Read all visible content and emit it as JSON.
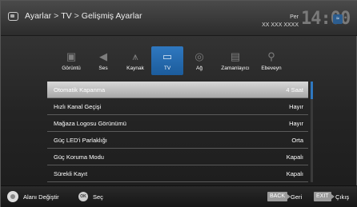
{
  "header": {
    "breadcrumb": [
      "Ayarlar",
      "TV",
      "Gelişmiş Ayarlar"
    ],
    "separator": ">",
    "day": "Per",
    "date": "XX XXX XXXX",
    "clock": "14:00",
    "badge": "≈"
  },
  "tabs": [
    {
      "label": "Görüntü",
      "icon": "picture-icon",
      "glyph": "▣",
      "active": false
    },
    {
      "label": "Ses",
      "icon": "speaker-icon",
      "glyph": "◀",
      "active": false
    },
    {
      "label": "Kaynak",
      "icon": "antenna-icon",
      "glyph": "⩚",
      "active": false
    },
    {
      "label": "TV",
      "icon": "tv-icon",
      "glyph": "▭",
      "active": true
    },
    {
      "label": "Ağ",
      "icon": "network-icon",
      "glyph": "◎",
      "active": false
    },
    {
      "label": "Zamanlayıcı",
      "icon": "timer-icon",
      "glyph": "▤",
      "active": false
    },
    {
      "label": "Ebeveyn",
      "icon": "parental-icon",
      "glyph": "⚲",
      "active": false
    }
  ],
  "settings": [
    {
      "label": "Otomatik Kapanma",
      "value": "4 Saat",
      "selected": true
    },
    {
      "label": "Hızlı Kanal Geçişi",
      "value": "Hayır",
      "selected": false
    },
    {
      "label": "Mağaza Logosu Görünümü",
      "value": "Hayır",
      "selected": false
    },
    {
      "label": "Güç LED'i Parlaklığı",
      "value": "Orta",
      "selected": false
    },
    {
      "label": "Güç Koruma Modu",
      "value": "Kapalı",
      "selected": false
    },
    {
      "label": "Sürekli Kayıt",
      "value": "Kapalı",
      "selected": false
    }
  ],
  "footer": {
    "nav_label": "Alanı Değiştir",
    "ok_label": "Seç",
    "ok_key": "OK",
    "back_key": "BACK",
    "back_label": "Geri",
    "exit_key": "EXIT",
    "exit_label": "Çıkış"
  },
  "colors": {
    "accent": "#2f78c0",
    "selected_row": "#bdbdbd",
    "key_bg": "#9a9a9a"
  }
}
